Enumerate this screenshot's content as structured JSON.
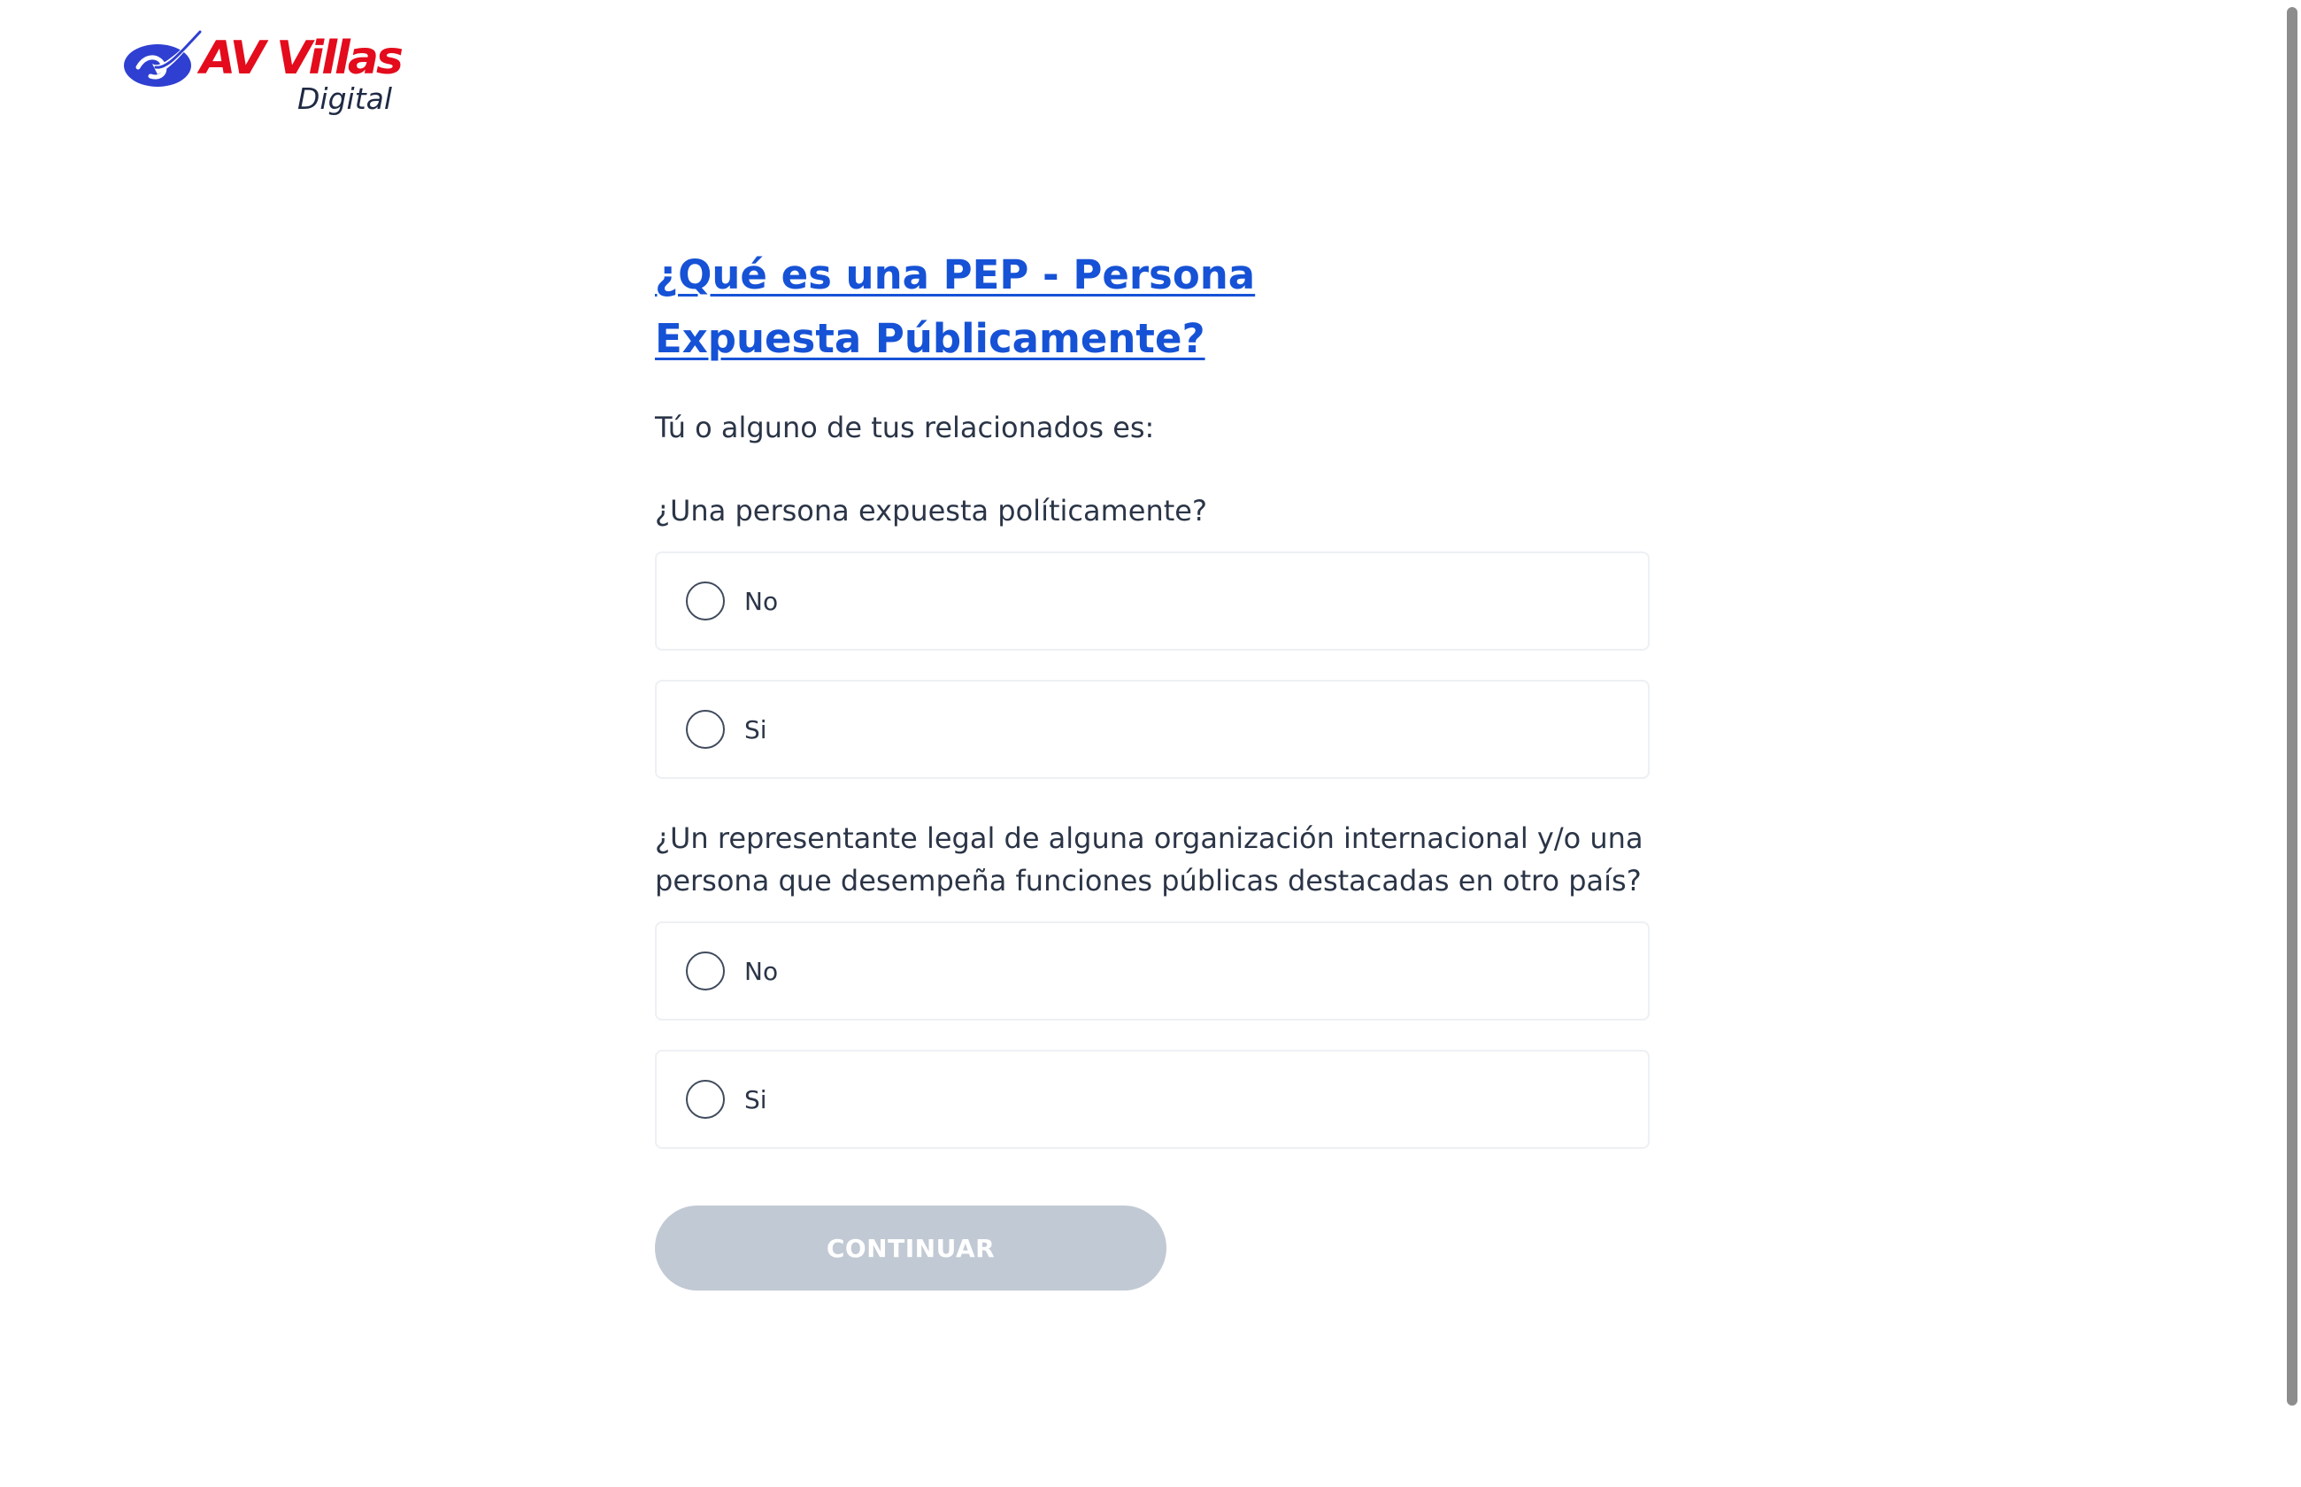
{
  "brand": {
    "name": "AV Villas",
    "subtitle": "Digital",
    "primary_color": "#e30b1c",
    "mark_color": "#2f3fd1"
  },
  "main": {
    "title": "¿Qué es una PEP - Persona Expuesta Públicamente?",
    "title_color": "#1652d6",
    "intro": "Tú o alguno de tus relacionados es:",
    "questions": [
      {
        "text": "¿Una persona expuesta políticamente?",
        "options": [
          {
            "label": "No",
            "selected": false
          },
          {
            "label": "Si",
            "selected": false
          }
        ]
      },
      {
        "text": "¿Un representante legal de alguna organización internacional y/o una persona que desempeña funciones públicas destacadas en otro país?",
        "options": [
          {
            "label": "No",
            "selected": false
          },
          {
            "label": "Si",
            "selected": false
          }
        ]
      }
    ],
    "continue_label": "CONTINUAR",
    "continue_enabled": false,
    "continue_disabled_color": "#c1c9d4"
  }
}
